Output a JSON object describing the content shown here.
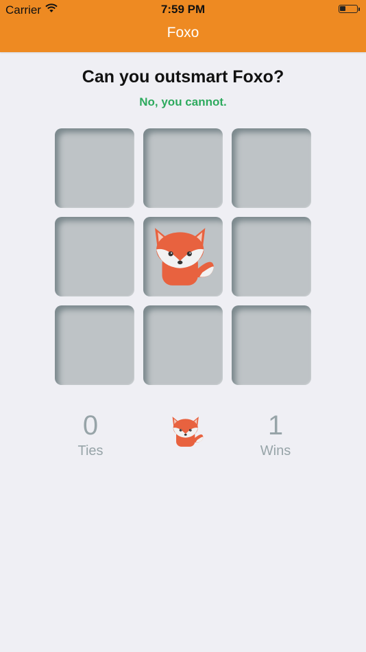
{
  "status_bar": {
    "carrier": "Carrier",
    "time": "7:59 PM"
  },
  "nav": {
    "title": "Foxo"
  },
  "game": {
    "headline": "Can you outsmart Foxo?",
    "result": "No, you cannot.",
    "board": [
      [
        "",
        "",
        ""
      ],
      [
        "",
        "fox",
        ""
      ],
      [
        "",
        "",
        ""
      ]
    ]
  },
  "scores": {
    "ties": {
      "value": "0",
      "label": "Ties"
    },
    "wins": {
      "value": "1",
      "label": "Wins"
    }
  },
  "colors": {
    "accent": "#ee8a22",
    "success": "#2eaa5e",
    "cell": "#bec3c6",
    "score_text": "#97a4a8",
    "fox": "#e8623f"
  },
  "icons": {
    "fox_piece": "fox-icon",
    "mascot": "fox-mascot-icon",
    "wifi": "wifi-icon",
    "battery": "battery-icon"
  }
}
